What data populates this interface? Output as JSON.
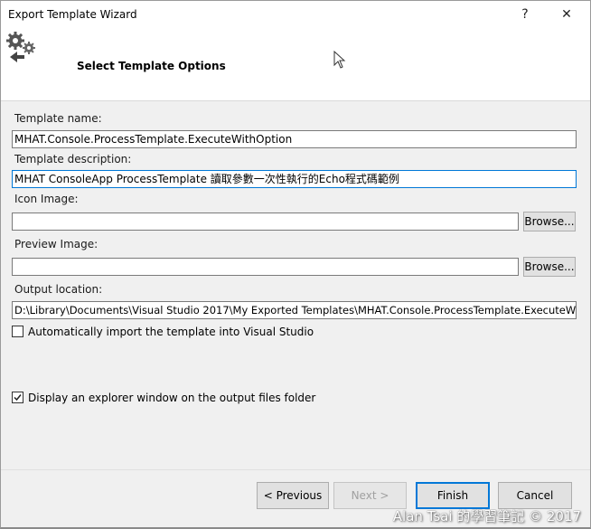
{
  "window": {
    "title": "Export Template Wizard",
    "help_glyph": "?",
    "close_glyph": "✕"
  },
  "header": {
    "title": "Select Template Options",
    "icon": "gears-export-icon"
  },
  "form": {
    "template_name_label": "Template name:",
    "template_name_value": "MHAT.Console.ProcessTemplate.ExecuteWithOption",
    "template_description_label": "Template description:",
    "template_description_value": "MHAT ConsoleApp ProcessTemplate 讀取參數一次性執行的Echo程式碼範例",
    "icon_image_label": "Icon Image:",
    "icon_image_value": "",
    "icon_browse_label": "Browse...",
    "preview_image_label": "Preview Image:",
    "preview_image_value": "",
    "preview_browse_label": "Browse...",
    "output_location_label": "Output location:",
    "output_location_value": "D:\\Library\\Documents\\Visual Studio 2017\\My Exported Templates\\MHAT.Console.ProcessTemplate.ExecuteWithOption",
    "auto_import_label": "Automatically import the template into Visual Studio",
    "auto_import_checked": false,
    "display_explorer_label": "Display an explorer window on the output files folder",
    "display_explorer_checked": true
  },
  "buttons": {
    "previous": "< Previous",
    "next": "Next >",
    "finish": "Finish",
    "cancel": "Cancel"
  },
  "watermark": "Alan Tsai 的學習筆記 © 2017",
  "colors": {
    "focus_border": "#0078d7",
    "dialog_bg": "#f0f0f0",
    "header_bg": "#ffffff"
  }
}
